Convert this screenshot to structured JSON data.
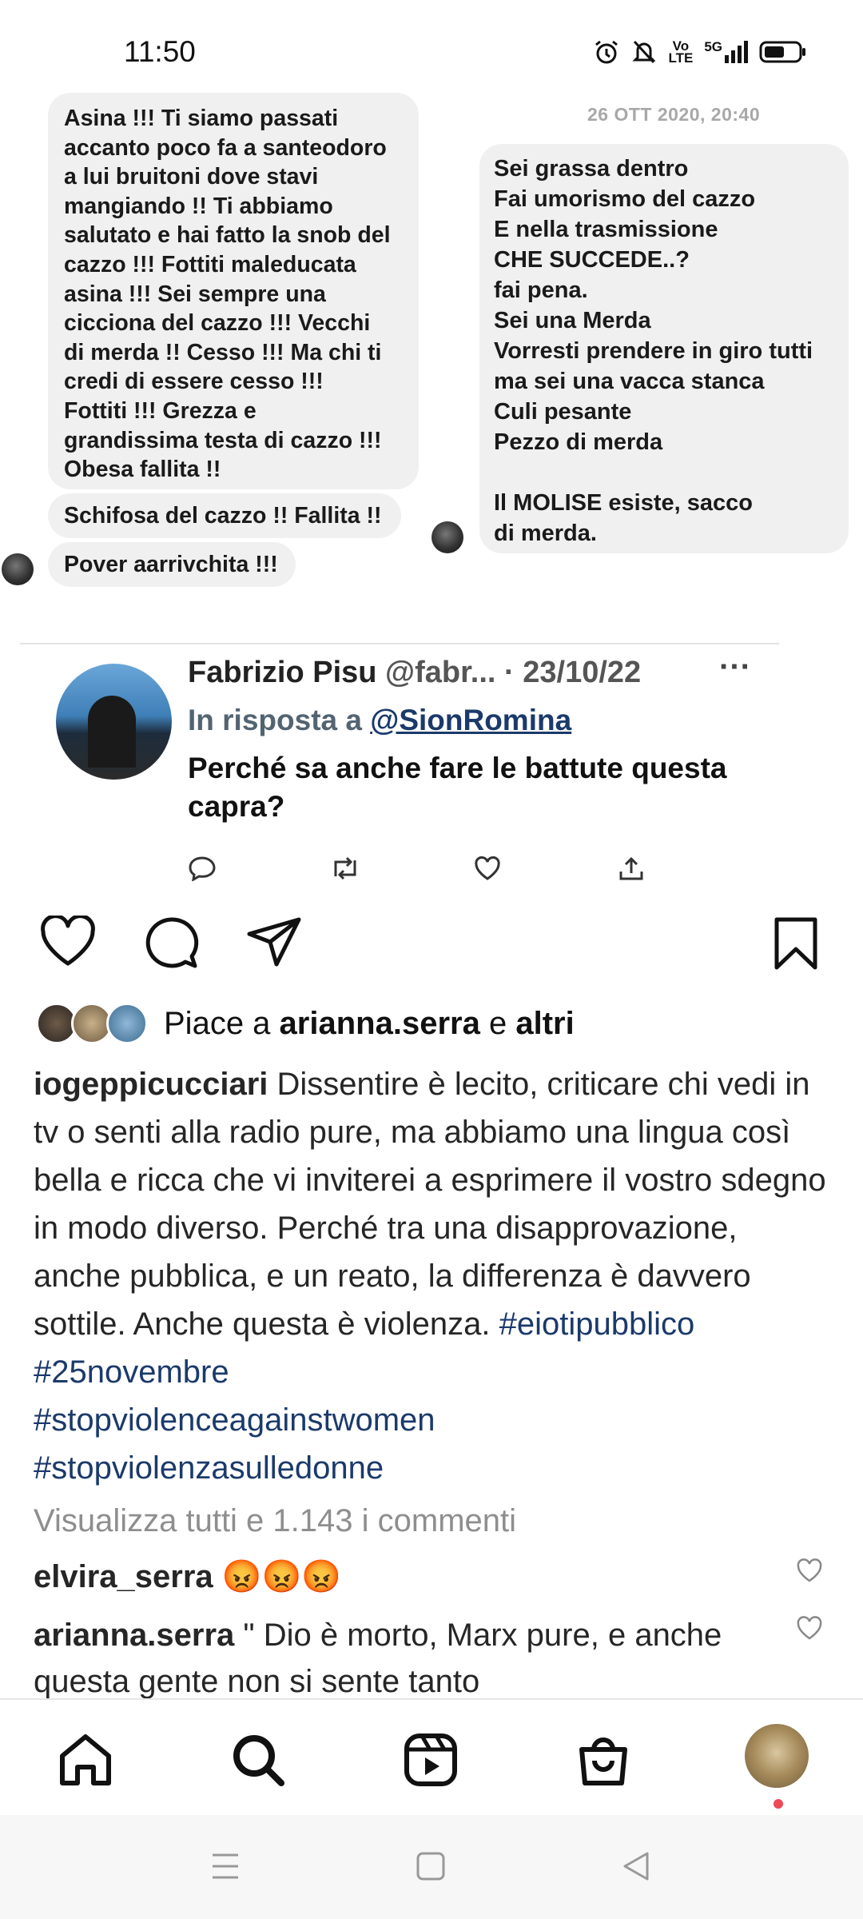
{
  "status_bar": {
    "time": "11:50",
    "network_label_top": "Vo",
    "network_label_bottom": "LTE",
    "signal_label": "5G"
  },
  "chat_screenshot": {
    "left_messages": [
      "Asina !!! Ti siamo passati\naccanto poco fa a santeodoro\na lui bruitoni dove stavi\nmangiando !! Ti abbiamo\nsalutato e hai fatto la snob del\ncazzo !!! Fottiti maleducata\nasina !!! Sei sempre una\ncicciona del cazzo !!! Vecchi\ndi merda !! Cesso !!! Ma chi ti\ncredi di essere cesso !!!\nFottiti !!! Grezza e\ngrandissima testa di cazzo !!!\nObesa fallita !!",
      "Schifosa del cazzo !! Fallita !!",
      "Pover aarrivchita !!!"
    ],
    "date": "26 OTT 2020, 20:40",
    "right_message": "Sei grassa dentro\nFai umorismo del cazzo\nE nella trasmissione\nCHE SUCCEDE..?\nfai pena.\nSei una Merda\nVorresti prendere in giro tutti\nma sei una vacca stanca\nCuli pesante\nPezzo di merda\n\nIl MOLISE esiste, sacco\ndi merda."
  },
  "tweet": {
    "author": "Fabrizio Pisu",
    "handle": "@fabr...",
    "date": "· 23/10/22",
    "more": "···",
    "reply_prefix": "In risposta a",
    "reply_to": "@SionRomina",
    "text": "Perché  sa anche fare le battute questa capra?"
  },
  "post": {
    "likes_prefix": "Piace a",
    "likes_user": "arianna.serra",
    "likes_joiner": "e",
    "likes_others": "altri",
    "caption_user": "iogeppicucciari",
    "caption_text": " Dissentire è lecito, criticare chi vedi in tv o senti alla radio pure, ma abbiamo una lingua così bella e ricca che vi inviterei a esprimere il vostro sdegno in modo diverso. Perché tra una disapprovazione, anche pubblica, e un reato, la differenza è davvero sottile. Anche questa è violenza. ",
    "hashtags": [
      "#eiotipubblico",
      "#25novembre",
      "#stopviolenceagainstwomen",
      "#stopviolenzasulledonne"
    ],
    "view_comments": "Visualizza tutti e 1.143 i commenti",
    "comments": [
      {
        "user": "elvira_serra",
        "text": " 😡😡😡"
      },
      {
        "user": "arianna.serra",
        "text": " \" Dio è morto, Marx pure, e anche questa gente non si sente tanto"
      }
    ]
  },
  "colors": {
    "hashtag": "#1b3a6b",
    "muted": "#8e8e8e",
    "notification_dot": "#ed4956"
  },
  "icons": {
    "post_actions": [
      "heart-icon",
      "comment-icon",
      "share-icon",
      "bookmark-icon"
    ],
    "bottom_nav": [
      "home-icon",
      "search-icon",
      "reels-icon",
      "shop-icon",
      "profile-avatar"
    ],
    "system_nav": [
      "menu-icon",
      "home-square-icon",
      "back-icon"
    ]
  }
}
